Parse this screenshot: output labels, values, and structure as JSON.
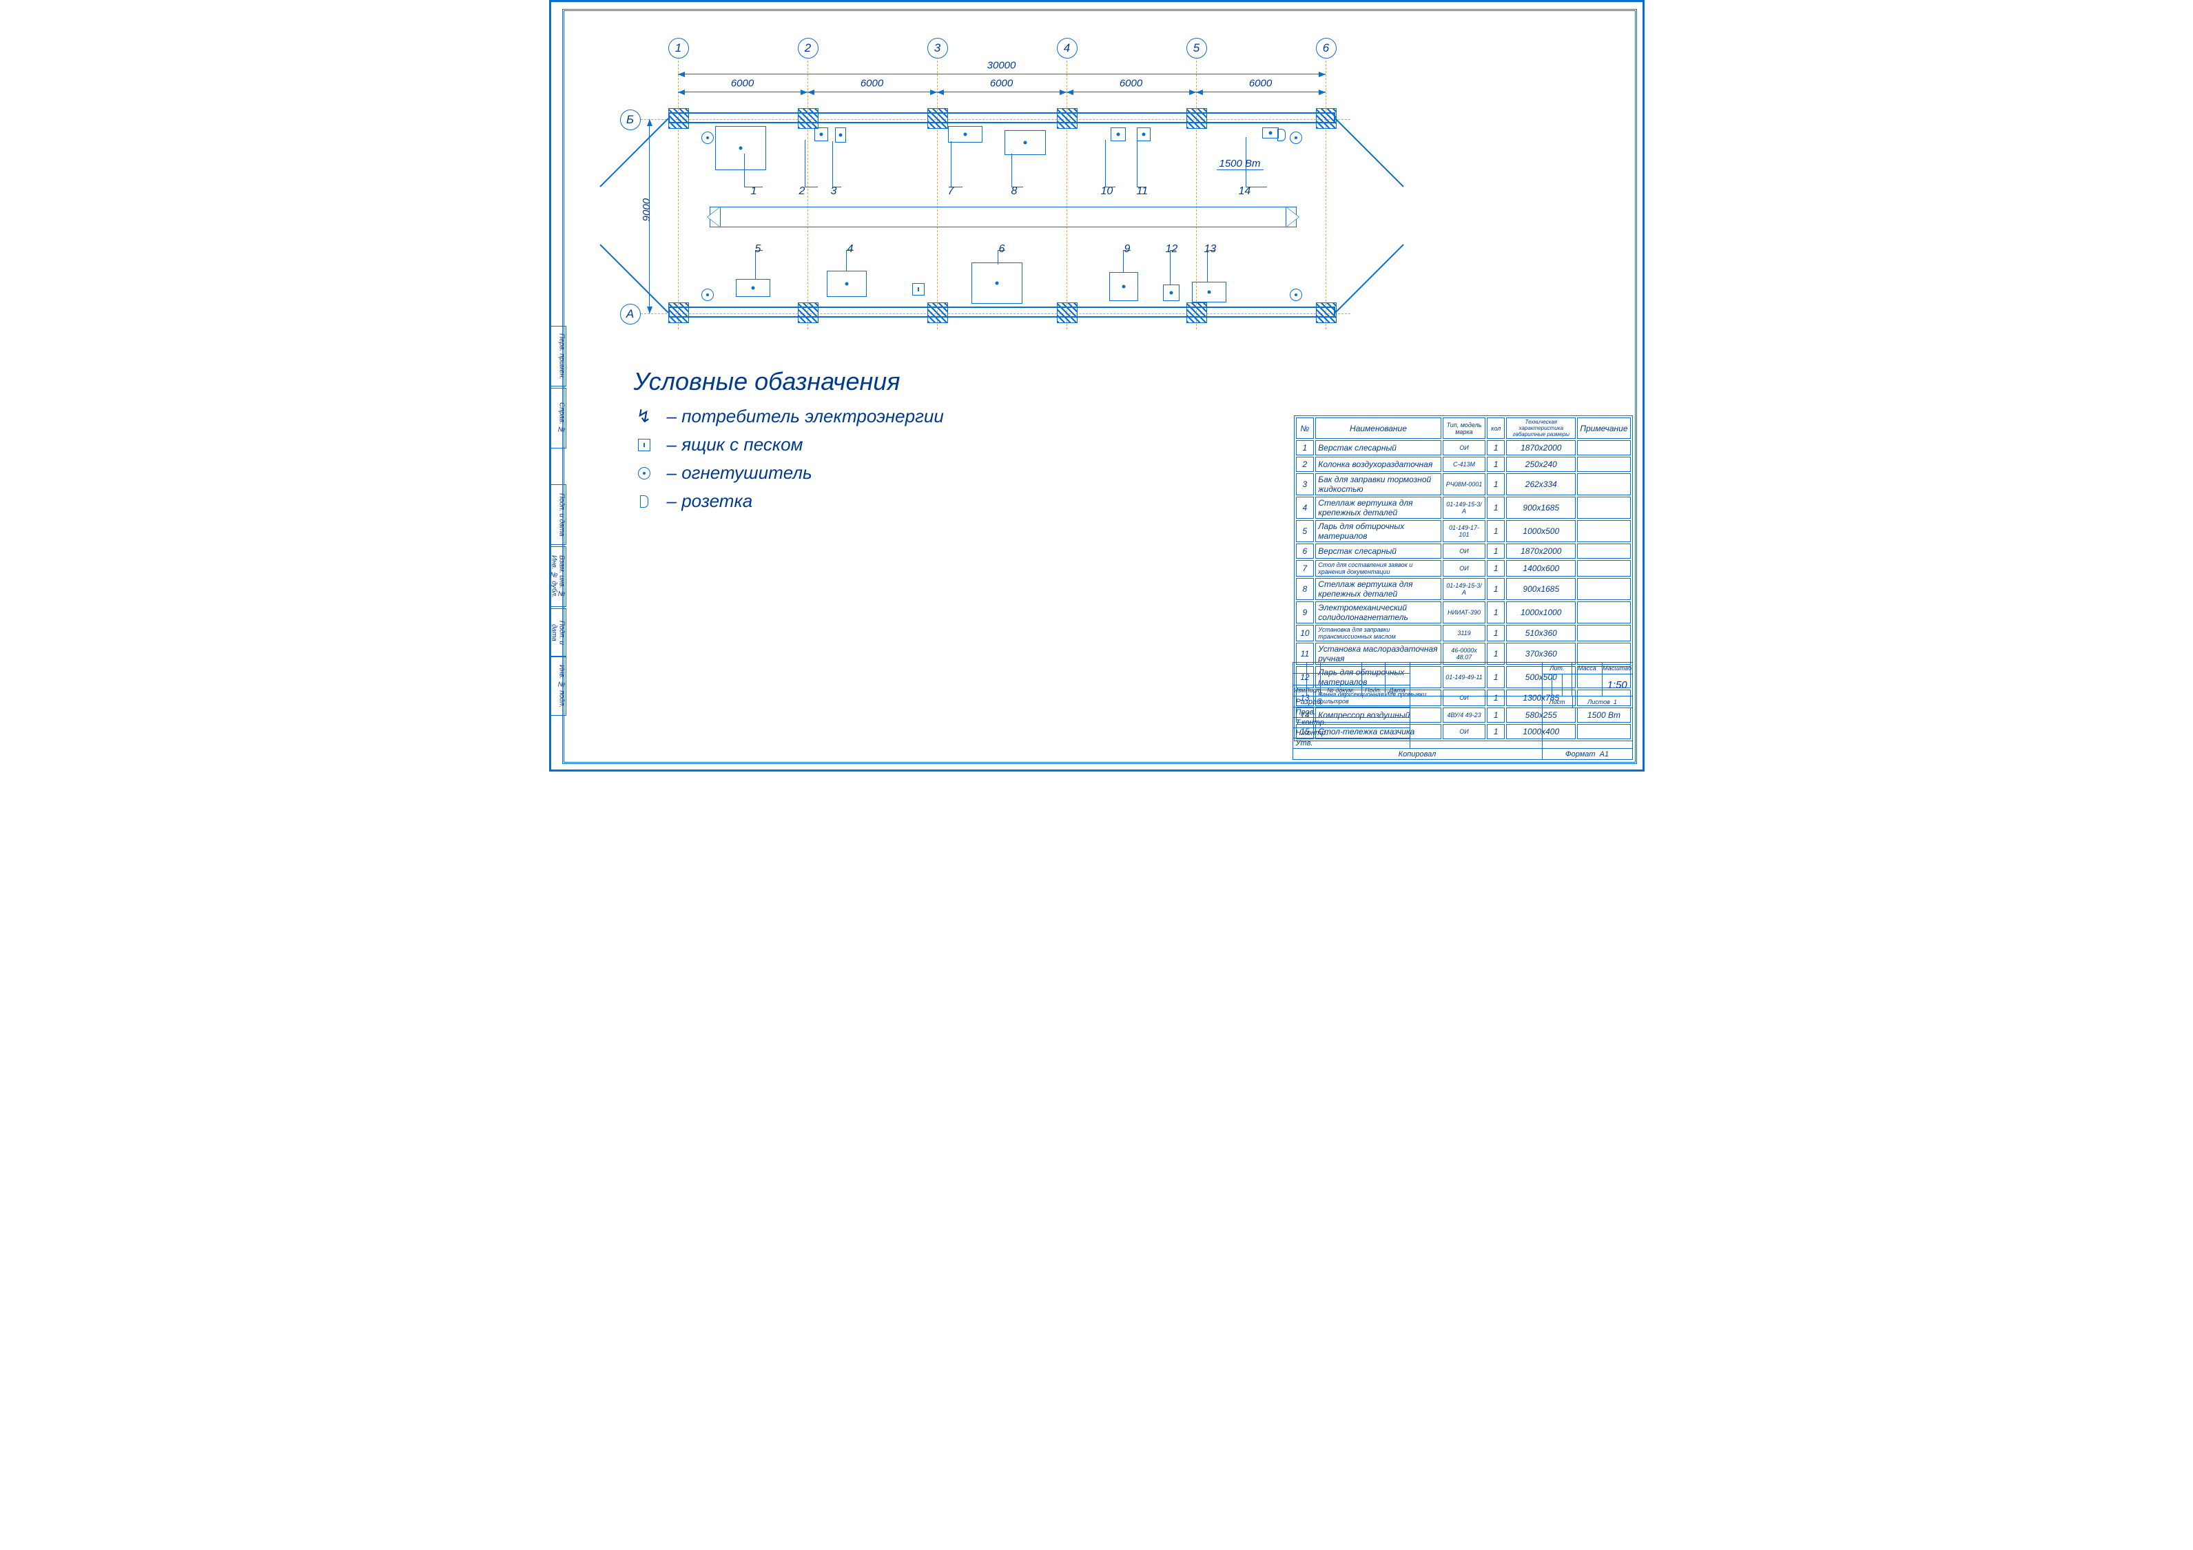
{
  "chart_data": {
    "type": "floor_plan",
    "grid_axes_numbered": [
      "1",
      "2",
      "3",
      "4",
      "5",
      "6"
    ],
    "grid_axes_lettered": [
      "А",
      "Б"
    ],
    "overall_width_mm": 30000,
    "bay_spacing_mm": [
      6000,
      6000,
      6000,
      6000,
      6000
    ],
    "depth_mm": 9000,
    "equipment_positions": [
      {
        "id": 1,
        "approx_bay": "1-2 Б",
        "size": "1870x2000"
      },
      {
        "id": 2,
        "approx_bay": "~2 Б",
        "size": "250x240"
      },
      {
        "id": 3,
        "approx_bay": "~2 Б",
        "size": "262x334"
      },
      {
        "id": 4,
        "approx_bay": "2-3 А",
        "size": "900x1685"
      },
      {
        "id": 5,
        "approx_bay": "1-2 А",
        "size": "1000x500"
      },
      {
        "id": 6,
        "approx_bay": "3-4 А",
        "size": "1870x2000"
      },
      {
        "id": 7,
        "approx_bay": "~3 Б",
        "size": "1400x600"
      },
      {
        "id": 8,
        "approx_bay": "3-4 Б",
        "size": "900x1685"
      },
      {
        "id": 9,
        "approx_bay": "~4 А",
        "size": "1000x1000"
      },
      {
        "id": 10,
        "approx_bay": "~4-5 Б",
        "size": "510x360"
      },
      {
        "id": 11,
        "approx_bay": "~4-5 Б",
        "size": "370x360"
      },
      {
        "id": 12,
        "approx_bay": "~5 А",
        "size": "500x500"
      },
      {
        "id": 13,
        "approx_bay": "~5 А",
        "size": "1300x785"
      },
      {
        "id": 14,
        "approx_bay": "~5-6 Б",
        "size": "580x255",
        "power": "1500 Вт"
      }
    ],
    "inspection_pit": {
      "between_axes": "1-6",
      "approx": "center"
    },
    "scale": "1:50"
  },
  "axes_num": [
    "1",
    "2",
    "3",
    "4",
    "5",
    "6"
  ],
  "axes_let": [
    "А",
    "Б"
  ],
  "dim_overall": "30000",
  "dim_bay": "6000",
  "dim_depth": "9000",
  "eq_labels": {
    "1": "1",
    "2": "2",
    "3": "3",
    "4": "4",
    "5": "5",
    "6": "6",
    "7": "7",
    "8": "8",
    "9": "9",
    "10": "10",
    "11": "11",
    "12": "12",
    "13": "13",
    "14": "14"
  },
  "power_label": "1500 Вт",
  "legend": {
    "title": "Условные обазначения",
    "items": [
      {
        "sym": "arrow",
        "text": "потребитель электроэнергии"
      },
      {
        "sym": "sandbox",
        "text": "ящик с песком"
      },
      {
        "sym": "extinguisher",
        "text": "огнетушитель"
      },
      {
        "sym": "outlet",
        "text": "розетка"
      }
    ],
    "dash": "–"
  },
  "spec_header": {
    "no": "№",
    "name": "Наименование",
    "model": "Тип, модель\nмарка",
    "qty": "кол",
    "tech": "Техническая характеристика\nгабаритные размеры",
    "note": "Примечание"
  },
  "spec_rows": [
    {
      "no": "1",
      "name": "Верстак слесарный",
      "model": "ОИ",
      "qty": "1",
      "tech": "1870х2000",
      "note": ""
    },
    {
      "no": "2",
      "name": "Колонка воздухораздаточная",
      "model": "С-413М",
      "qty": "1",
      "tech": "250х240",
      "note": ""
    },
    {
      "no": "3",
      "name": "Бак для заправки тормозной жидкостью",
      "model": "РЧ08М-0001",
      "qty": "1",
      "tech": "262х334",
      "note": ""
    },
    {
      "no": "4",
      "name": "Стеллаж вертушка для крепежных деталей",
      "model": "01-149-15-3/А",
      "qty": "1",
      "tech": "900х1685",
      "note": ""
    },
    {
      "no": "5",
      "name": "Ларь для обтирочных материалов",
      "model": "01-149-17-101",
      "qty": "1",
      "tech": "1000х500",
      "note": ""
    },
    {
      "no": "6",
      "name": "Верстак слесарный",
      "model": "ОИ",
      "qty": "1",
      "tech": "1870х2000",
      "note": ""
    },
    {
      "no": "7",
      "name": "Стол для составления заявок и хранения документации",
      "model": "ОИ",
      "qty": "1",
      "tech": "1400х600",
      "note": ""
    },
    {
      "no": "8",
      "name": "Стеллаж вертушка для крепежных деталей",
      "model": "01-149-15-3/А",
      "qty": "1",
      "tech": "900х1685",
      "note": ""
    },
    {
      "no": "9",
      "name": "Электромеханический солидолонагнетатель",
      "model": "НИИАТ-390",
      "qty": "1",
      "tech": "1000х1000",
      "note": ""
    },
    {
      "no": "10",
      "name": "Установка для заправки трансмиссионных маслом",
      "model": "3119",
      "qty": "1",
      "tech": "510х360",
      "note": ""
    },
    {
      "no": "11",
      "name": "Установка маслораздаточная ручная",
      "model": "46-0000х 48.07",
      "qty": "1",
      "tech": "370х360",
      "note": ""
    },
    {
      "no": "12",
      "name": "Ларь для обтирочных материалов",
      "model": "01-149-49-11",
      "qty": "1",
      "tech": "500х500",
      "note": ""
    },
    {
      "no": "13",
      "name": "Ванна двухсекционная для промывки фильтров",
      "model": "ОИ",
      "qty": "1",
      "tech": "1300х785",
      "note": ""
    },
    {
      "no": "14",
      "name": "Компрессор воздушный",
      "model": "4ВУ/4 49-23",
      "qty": "1",
      "tech": "580х255",
      "note": "1500 Вт"
    },
    {
      "no": "15",
      "name": "Стол-тележка смазчика",
      "model": "ОИ",
      "qty": "1",
      "tech": "1000х400",
      "note": ""
    }
  ],
  "titleblock": {
    "cols": [
      "Изм",
      "Лист",
      "№ докум.",
      "Подп.",
      "Дата"
    ],
    "rows": [
      "Разраб.",
      "Пров.",
      "Т.контр.",
      "Н.контр.",
      "Утв."
    ],
    "right_cols_top": [
      "Лит.",
      "Масса",
      "Масштаб"
    ],
    "scale": "1:50",
    "sheet_label": "Лист",
    "sheets_label": "Листов",
    "sheets_val": "1",
    "bottom": {
      "copy": "Копировал",
      "format": "Формат",
      "format_val": "А1"
    }
  },
  "side_stamps": [
    "Перв. примен.",
    "Справ. №",
    "Подп. и дата",
    "Взам. инв. №  Инв. № дубл.",
    "Подп. и дата",
    "Инв. № подл."
  ]
}
